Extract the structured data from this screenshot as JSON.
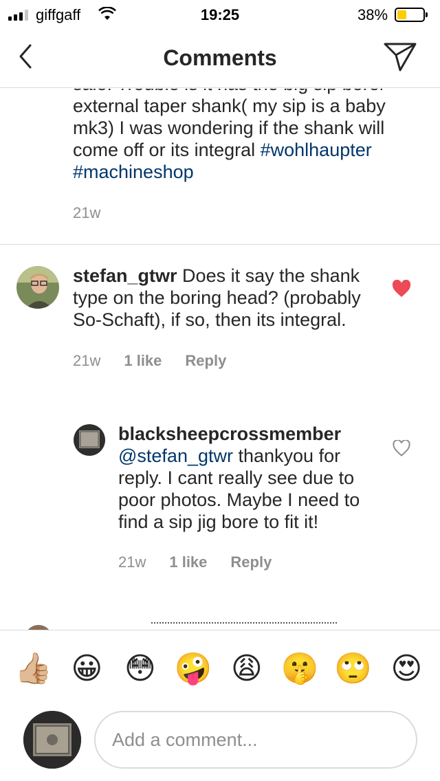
{
  "status": {
    "carrier": "giffgaff",
    "time": "19:25",
    "battery": "38%",
    "battery_level": 0.38
  },
  "nav": {
    "title": "Comments",
    "back_icon": "chevron-left-icon",
    "send_icon": "paper-plane-icon"
  },
  "comments": [
    {
      "text_lines": [
        "sale. Trouble is it has the big sip borer",
        "external taper shank( my sip is a baby",
        "mk3) I was wondering if the shank will",
        "come off or its integral "
      ],
      "tag1": "#wohlhaupter",
      "tag2": "#machineshop",
      "age": "21w"
    },
    {
      "username": "stefan_gtwr",
      "text": " Does it say the shank type on the boring head? (probably So-Schaft), if so, then its integral.",
      "age": "21w",
      "likes": "1 like",
      "reply": "Reply",
      "liked": true
    },
    {
      "username": "blacksheepcrossmember",
      "mention": "@stefan_gtwr",
      "text": " thankyou for reply. I cant really see due to poor photos. Maybe I need to find a sip jig bore to fit it!",
      "age": "21w",
      "likes": "1 like",
      "reply": "Reply",
      "liked": false
    }
  ],
  "emojis": [
    "👍🏼",
    "😀",
    "😳",
    "🤪",
    "😩",
    "🤫",
    "🙄",
    "😍"
  ],
  "input": {
    "placeholder": "Add a comment..."
  }
}
